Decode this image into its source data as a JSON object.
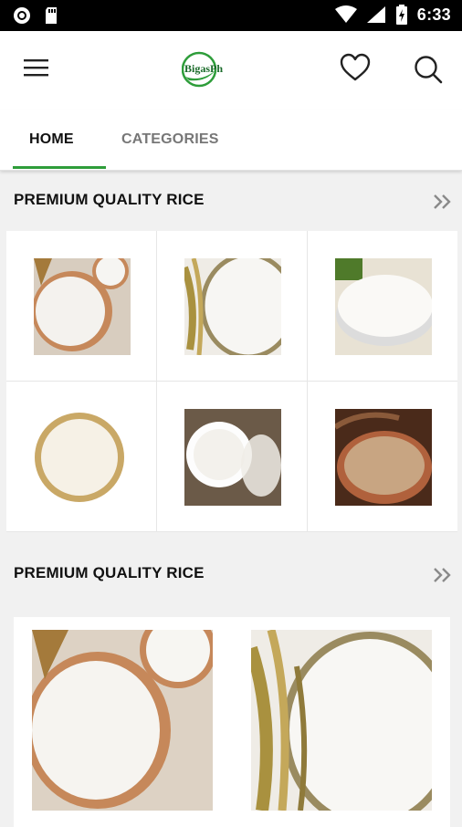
{
  "status_bar": {
    "time": "6:33"
  },
  "app_bar": {
    "logo_text": "BigasPh"
  },
  "tabs": [
    {
      "label": "HOME"
    },
    {
      "label": "CATEGORIES"
    }
  ],
  "sections": [
    {
      "title": "PREMIUM QUALITY RICE"
    },
    {
      "title": "PREMIUM QUALITY RICE"
    }
  ],
  "colors": {
    "accent": "#2e9d3a",
    "background": "#f1f1f1",
    "status_bar": "#000000"
  }
}
